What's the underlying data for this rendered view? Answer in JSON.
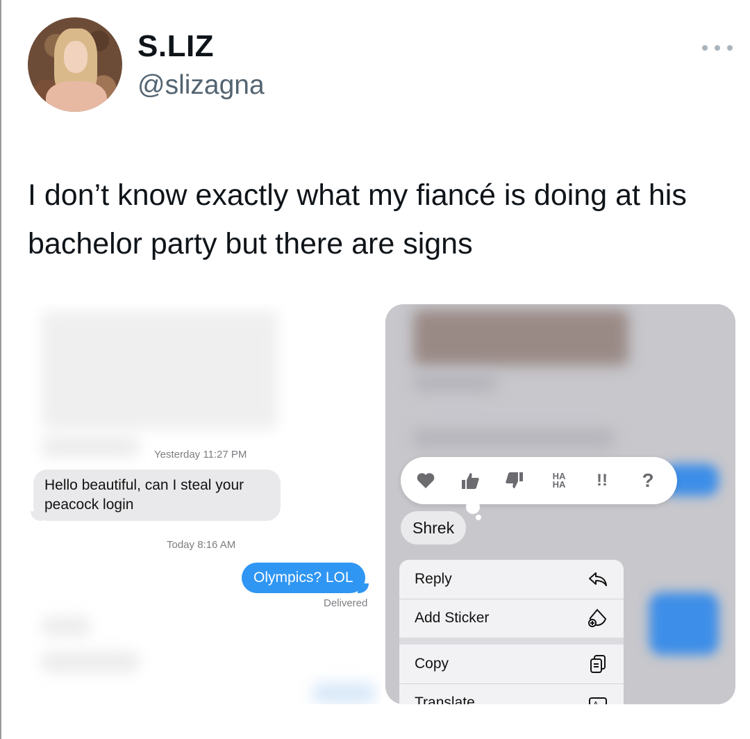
{
  "tweet": {
    "author_name": "S.LIZ",
    "author_handle": "@slizagna",
    "text": "I don’t know exactly what my fiancé is doing at his bachelor party but there are signs",
    "more_icon": "more-horizontal-icon"
  },
  "left_screenshot": {
    "timestamp_1": "Yesterday 11:27 PM",
    "incoming_message": "Hello beautiful, can I steal your peacock login",
    "timestamp_2": "Today 8:16 AM",
    "outgoing_message": "Olympics? LOL",
    "status": "Delivered"
  },
  "right_screenshot": {
    "reactions": [
      {
        "icon": "heart-icon",
        "glyph": "❤"
      },
      {
        "icon": "thumbs-up-icon",
        "glyph": "👍"
      },
      {
        "icon": "thumbs-down-icon",
        "glyph": "👎"
      },
      {
        "icon": "haha-icon",
        "glyph": "HA HA"
      },
      {
        "icon": "exclamation-icon",
        "glyph": "!!"
      },
      {
        "icon": "question-icon",
        "glyph": "?"
      }
    ],
    "reacted_message": "Shrek",
    "menu": {
      "reply": "Reply",
      "add_sticker": "Add Sticker",
      "copy": "Copy",
      "translate": "Translate"
    }
  }
}
